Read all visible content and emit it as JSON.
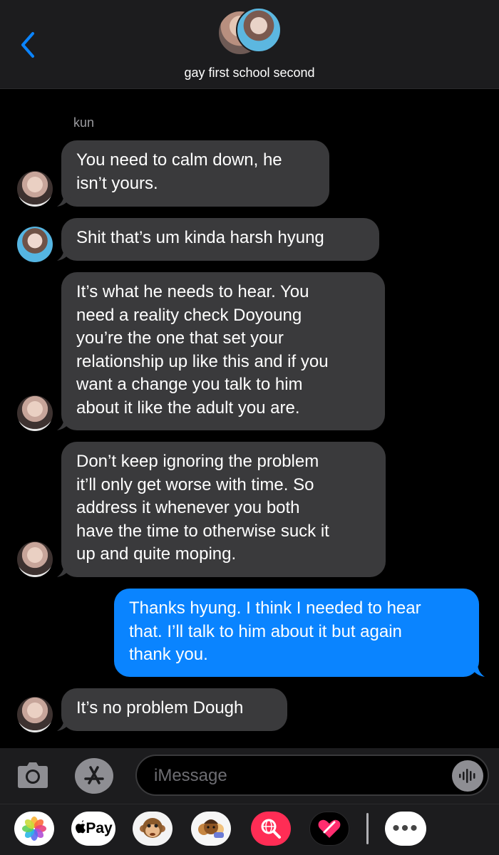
{
  "header": {
    "title": "gay first school second"
  },
  "conversation": {
    "sender_name": "kun",
    "messages": [
      {
        "from": "kun",
        "lines": [
          "You need to calm down, he",
          "isn’t yours."
        ]
      },
      {
        "from": "other",
        "lines": [
          "Shit that’s um kinda harsh hyung"
        ]
      },
      {
        "from": "kun",
        "lines": [
          "It’s what he needs to hear. You",
          "need a reality check Doyoung",
          "you’re the one that set your",
          "relationship up like this and if you",
          "want a change you talk to him",
          "about it like the adult you are."
        ]
      },
      {
        "from": "kun",
        "lines": [
          "Don’t keep ignoring the problem",
          "it’ll only get worse with time. So",
          "address it whenever you both",
          "have the time to otherwise suck it",
          "up and quite moping."
        ]
      },
      {
        "from": "me",
        "lines": [
          "Thanks hyung. I think I needed to hear",
          "that. I’ll talk to him about it but again",
          "thank you."
        ]
      },
      {
        "from": "kun",
        "lines": [
          "It’s no problem Dough"
        ]
      }
    ]
  },
  "input": {
    "placeholder": "iMessage"
  },
  "drawer": {
    "pay_label": "Pay",
    "more_label": "•••"
  },
  "colors": {
    "incoming": "#3a3a3c",
    "outgoing": "#0a84ff",
    "accent": "#0a84ff"
  }
}
